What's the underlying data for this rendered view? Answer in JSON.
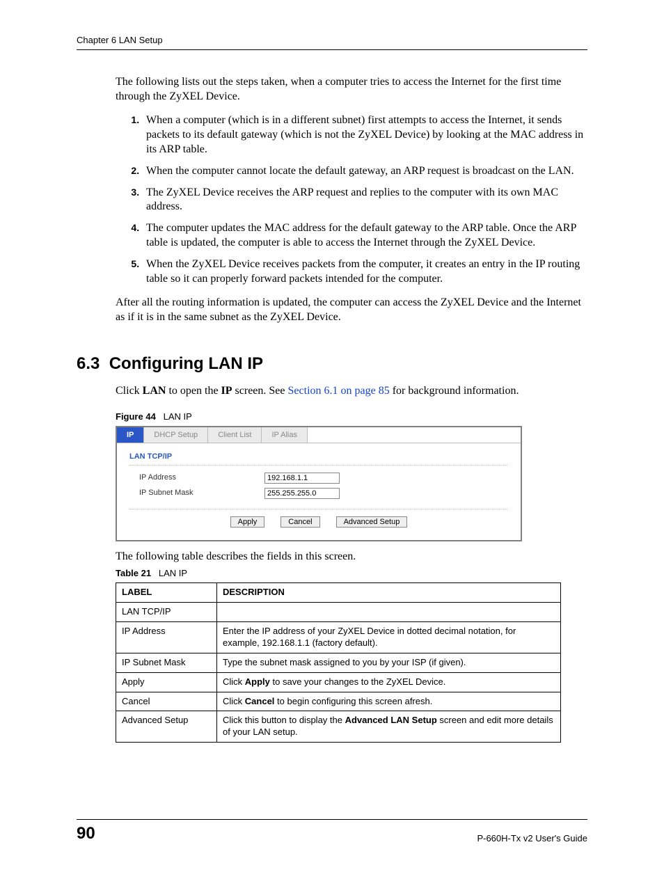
{
  "header": {
    "chapter": "Chapter 6 LAN Setup"
  },
  "intro": "The following lists out the steps taken, when a computer tries to access the Internet for the first time through the ZyXEL Device.",
  "steps": [
    "When a computer (which is in a different subnet) first attempts to access the Internet, it sends packets to its default gateway (which is not the ZyXEL Device) by looking at the MAC address in its ARP table.",
    "When the computer cannot locate the default gateway, an ARP request is broadcast on the LAN.",
    "The ZyXEL Device receives the ARP request and replies to the computer with its own MAC address.",
    "The computer updates the MAC address for the default gateway to the ARP table. Once the ARP table is updated, the computer is able to access the Internet through the ZyXEL Device.",
    "When the ZyXEL Device receives packets from the computer, it creates an entry in the IP routing table so it can properly forward packets intended for the computer."
  ],
  "after": "After all the routing information is updated, the computer can access the ZyXEL Device and the Internet as if it is in the same subnet as the ZyXEL Device.",
  "section": {
    "number": "6.3",
    "title": "Configuring LAN IP"
  },
  "click_line": {
    "pre": "Click ",
    "b1": "LAN",
    "mid1": " to open the ",
    "b2": "IP",
    "mid2": " screen. See ",
    "link": "Section 6.1 on page 85",
    "post": " for background information."
  },
  "figure": {
    "caption_label": "Figure 44",
    "caption_text": "LAN IP",
    "tabs": [
      "IP",
      "DHCP Setup",
      "Client List",
      "IP Alias"
    ],
    "panel_title": "LAN TCP/IP",
    "fields": {
      "ip_label": "IP Address",
      "ip_value": "192.168.1.1",
      "mask_label": "IP Subnet Mask",
      "mask_value": "255.255.255.0"
    },
    "buttons": {
      "apply": "Apply",
      "cancel": "Cancel",
      "advanced": "Advanced Setup"
    }
  },
  "post_fig": "The following table describes the fields in this screen.",
  "table": {
    "caption_label": "Table 21",
    "caption_text": "LAN IP",
    "headers": {
      "label": "LABEL",
      "desc": "DESCRIPTION"
    },
    "rows": [
      {
        "label": "LAN TCP/IP",
        "desc": ""
      },
      {
        "label": "IP Address",
        "desc": "Enter the IP address of your ZyXEL Device in dotted decimal notation, for example, 192.168.1.1 (factory default)."
      },
      {
        "label": "IP Subnet Mask",
        "desc": "Type the subnet mask assigned to you by your ISP (if given)."
      },
      {
        "label": "Apply",
        "desc_pre": "Click ",
        "desc_b": "Apply",
        "desc_post": " to save your changes to the ZyXEL Device."
      },
      {
        "label": "Cancel",
        "desc_pre": "Click ",
        "desc_b": "Cancel",
        "desc_post": " to begin configuring this screen afresh."
      },
      {
        "label": "Advanced Setup",
        "desc_pre": "Click this button to display the ",
        "desc_b": "Advanced LAN Setup",
        "desc_post": " screen and edit more details of your LAN setup."
      }
    ]
  },
  "footer": {
    "page": "90",
    "guide": "P-660H-Tx v2 User's Guide"
  }
}
